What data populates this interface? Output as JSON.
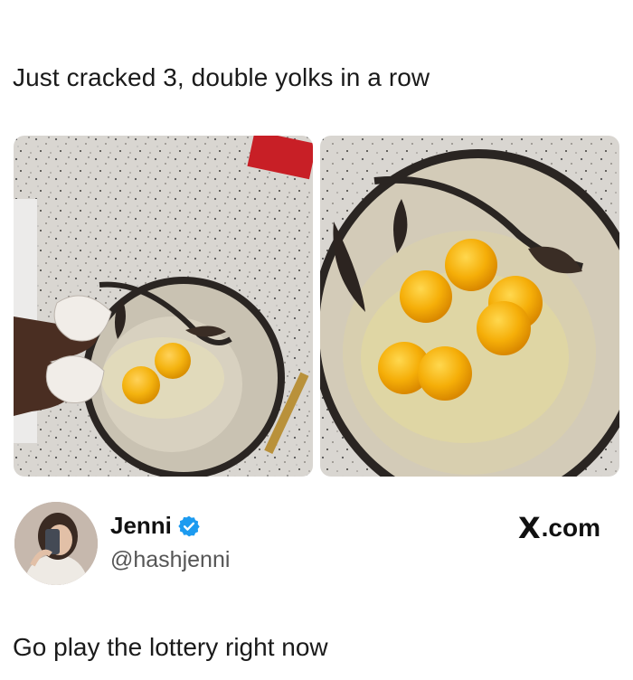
{
  "post": {
    "caption": "Just cracked 3, double yolks in a row"
  },
  "photos": {
    "left_alt": "egg bowl with shell",
    "right_alt": "bowl with six yolks"
  },
  "author": {
    "name": "Jenni",
    "handle": "@hashjenni",
    "verified": true
  },
  "source": {
    "site": ".com",
    "logo": "X"
  },
  "tweet": {
    "text": "Go play the lottery right now"
  },
  "colors": {
    "yolk": "#f4b30f",
    "verified": "#1d9bf0",
    "text": "#111111",
    "handle": "#555555"
  }
}
